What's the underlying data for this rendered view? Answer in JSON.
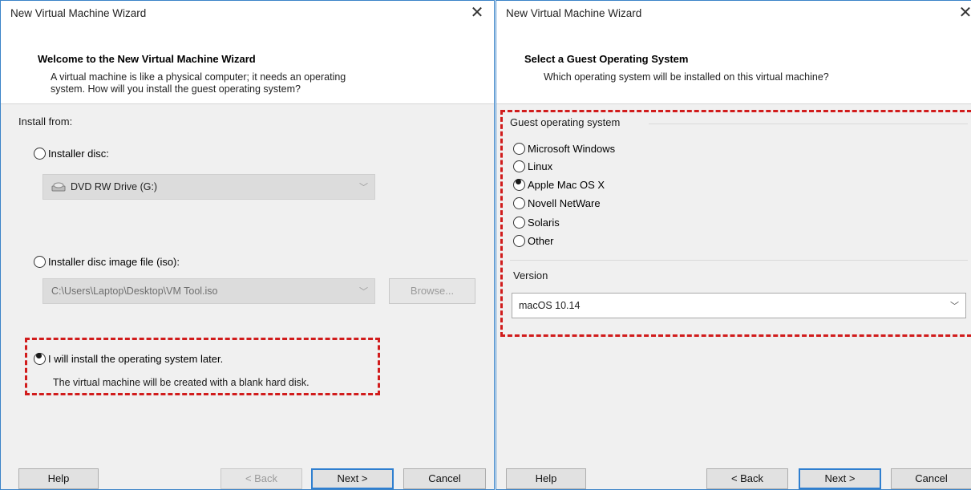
{
  "left": {
    "window_title": "New Virtual Machine Wizard",
    "header_title": "Welcome to the New Virtual Machine Wizard",
    "header_sub_line1": "A virtual machine is like a physical computer; it needs an operating",
    "header_sub_line2": "system. How will you install the guest operating system?",
    "install_from": "Install from:",
    "option_disc": "Installer disc:",
    "disc_drive": "DVD RW Drive (G:)",
    "option_iso": "Installer disc image file (iso):",
    "iso_path": "C:\\Users\\Laptop\\Desktop\\VM Tool.iso",
    "browse": "Browse...",
    "option_later": "I will install the operating system later.",
    "later_note": "The virtual machine will be created with a blank hard disk.",
    "buttons": {
      "help": "Help",
      "back": "< Back",
      "next": "Next >",
      "cancel": "Cancel"
    }
  },
  "right": {
    "window_title": "New Virtual Machine Wizard",
    "header_title": "Select a Guest Operating System",
    "header_sub": "Which operating system will be installed on this virtual machine?",
    "guest_os_label": "Guest operating system",
    "os_options": [
      "Microsoft Windows",
      "Linux",
      "Apple Mac OS X",
      "Novell NetWare",
      "Solaris",
      "Other"
    ],
    "selected_os": "Apple Mac OS X",
    "version_label": "Version",
    "version_value": "macOS 10.14",
    "buttons": {
      "help": "Help",
      "back": "< Back",
      "next": "Next >",
      "cancel": "Cancel"
    }
  },
  "colors": {
    "highlight": "#d11c1c",
    "accent": "#2f7fd0",
    "window_border": "#3c84c8"
  }
}
